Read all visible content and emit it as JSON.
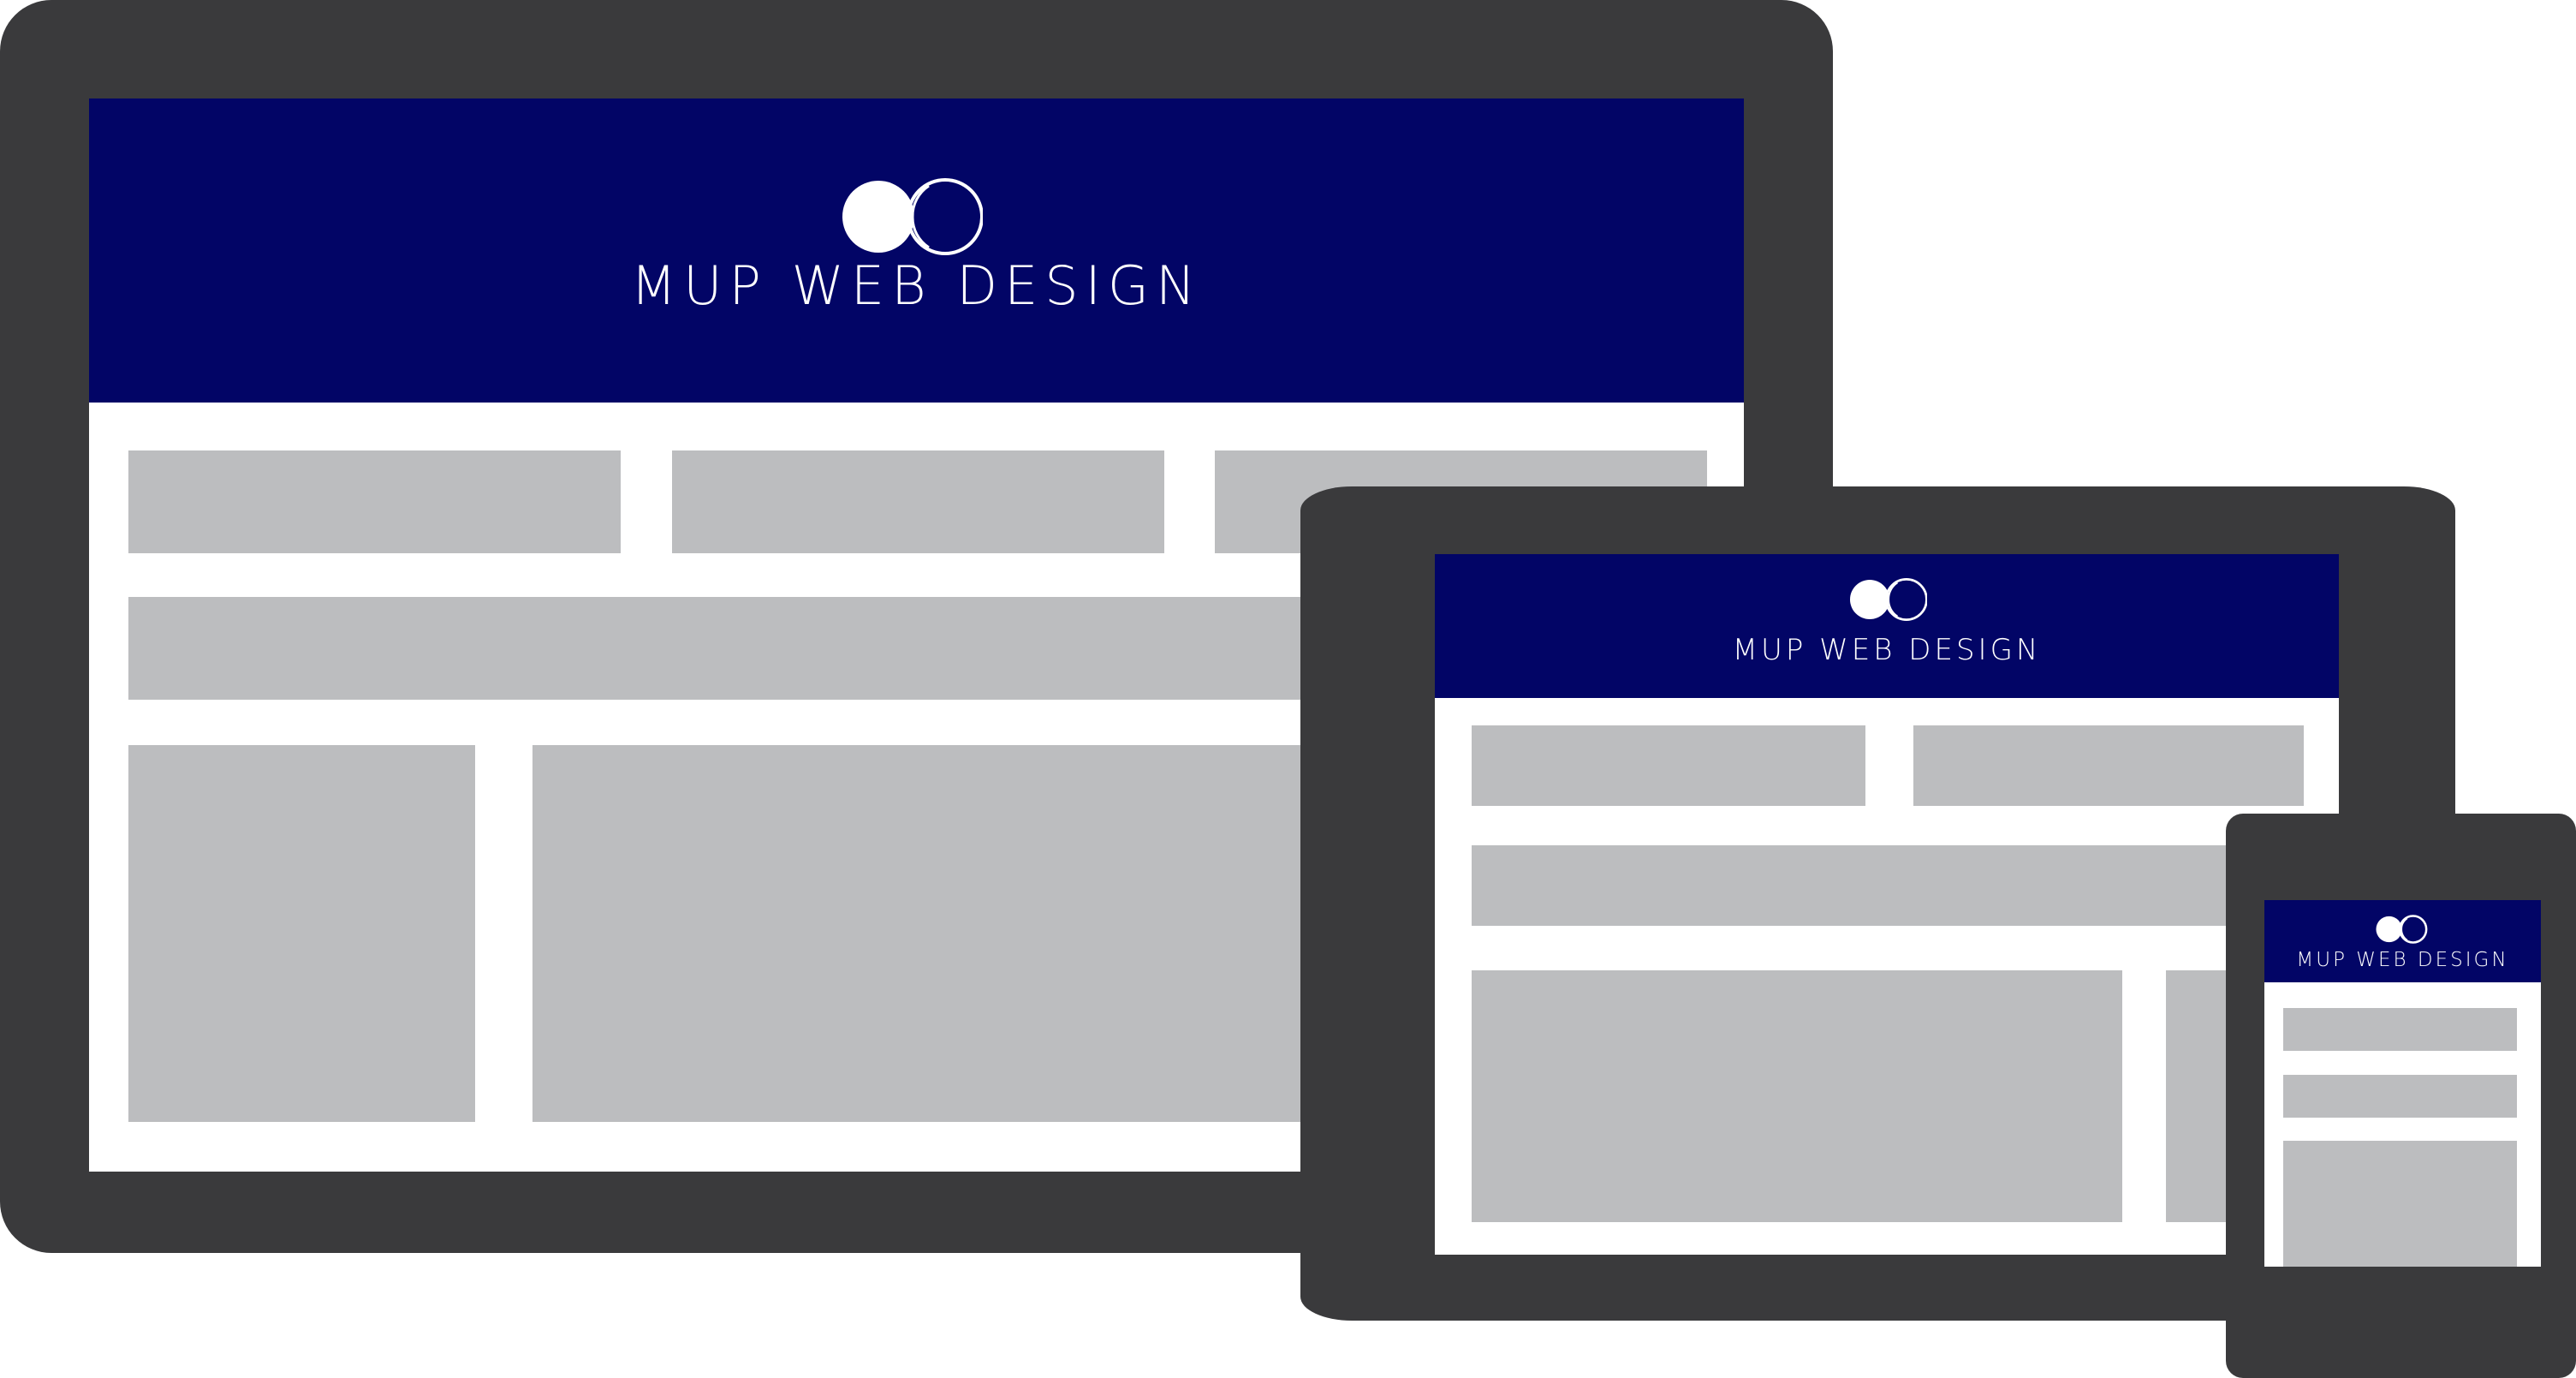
{
  "brand": {
    "name": "MUP WEB DESIGN",
    "logo_icon": "interlocking-circles-logo"
  },
  "colors": {
    "header": "#020566",
    "device_frame": "#3a3a3c",
    "placeholder_block": "#bcbdbf",
    "screen_background": "#ffffff",
    "logo": "#ffffff"
  },
  "devices": [
    {
      "name": "desktop-monitor",
      "placeholder_blocks": 6
    },
    {
      "name": "tablet",
      "placeholder_blocks": 5
    },
    {
      "name": "phone",
      "placeholder_blocks": 3
    }
  ]
}
